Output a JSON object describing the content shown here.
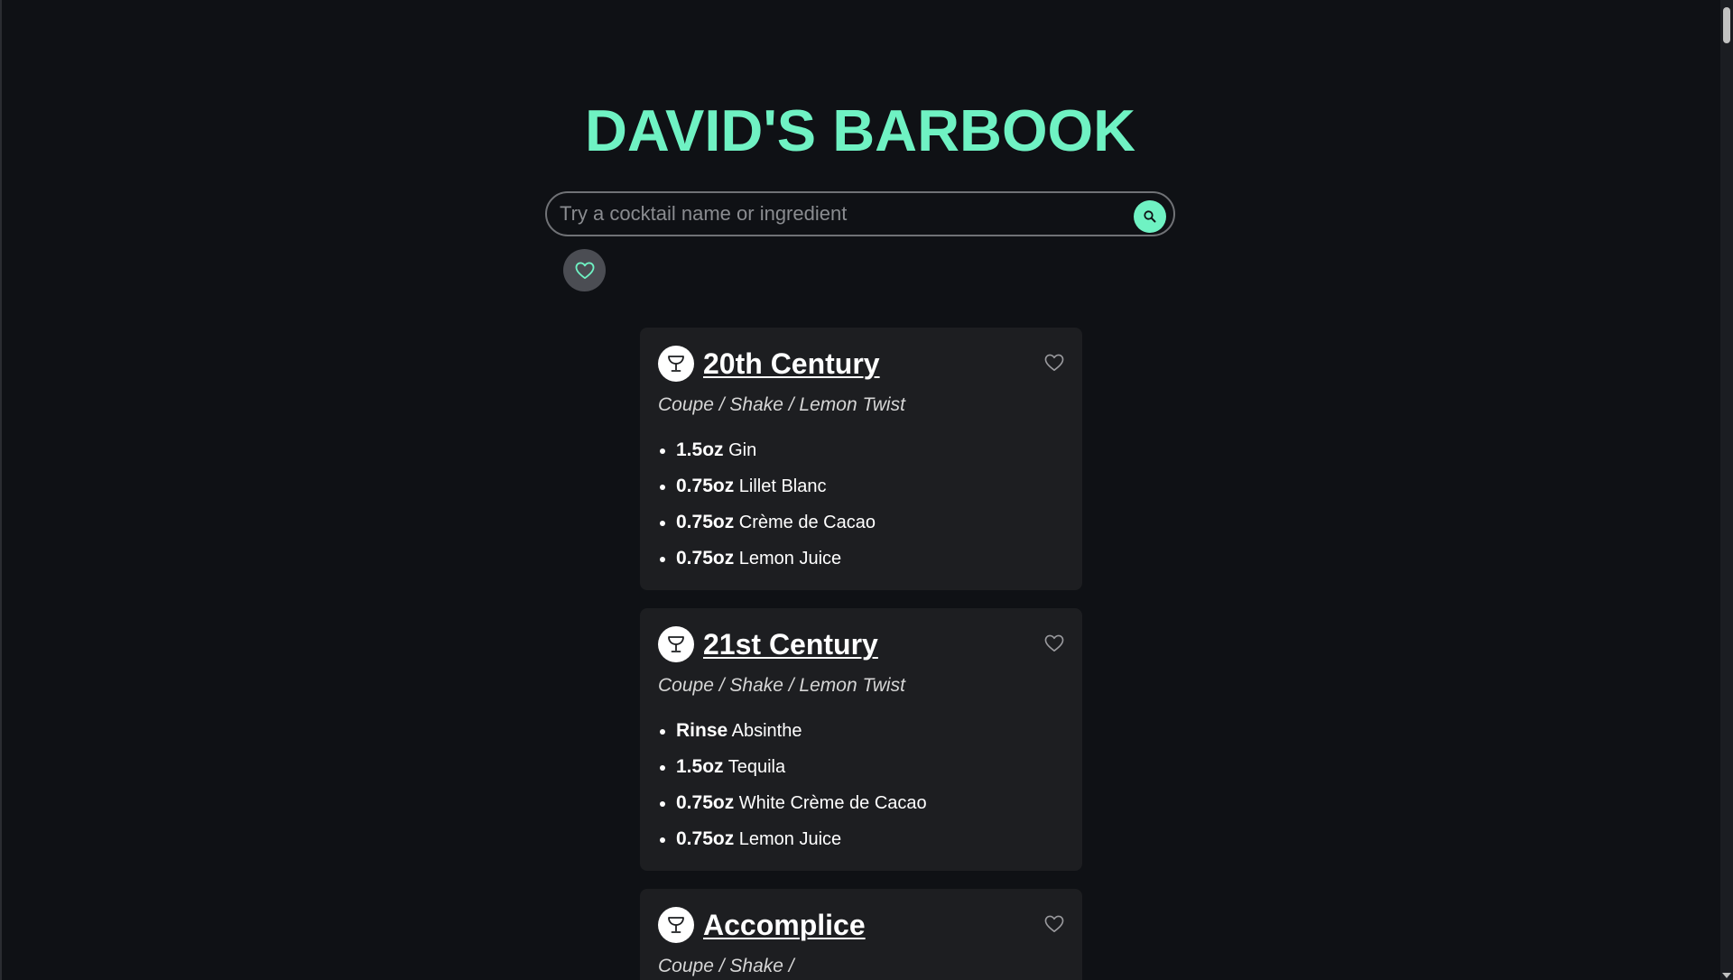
{
  "header": {
    "title": "DAVID'S BARBOOK"
  },
  "search": {
    "placeholder": "Try a cocktail name or ingredient",
    "value": "",
    "button_icon": "search-icon"
  },
  "favorites_filter": {
    "icon": "heart-icon"
  },
  "colors": {
    "background": "#0f1115",
    "accent": "#6ff2c3",
    "card": "#1d1e21"
  },
  "cocktails": [
    {
      "name": "20th Century",
      "meta": "Coupe / Shake / Lemon Twist",
      "ingredients": [
        {
          "amount": "1.5oz",
          "name": "Gin"
        },
        {
          "amount": "0.75oz",
          "name": "Lillet Blanc"
        },
        {
          "amount": "0.75oz",
          "name": "Crème de Cacao"
        },
        {
          "amount": "0.75oz",
          "name": "Lemon Juice"
        }
      ]
    },
    {
      "name": "21st Century",
      "meta": "Coupe / Shake / Lemon Twist",
      "ingredients": [
        {
          "amount": "Rinse",
          "name": "Absinthe"
        },
        {
          "amount": "1.5oz",
          "name": "Tequila"
        },
        {
          "amount": "0.75oz",
          "name": "White Crème de Cacao"
        },
        {
          "amount": "0.75oz",
          "name": "Lemon Juice"
        }
      ]
    },
    {
      "name": "Accomplice",
      "meta": "Coupe / Shake /",
      "ingredients": []
    }
  ]
}
